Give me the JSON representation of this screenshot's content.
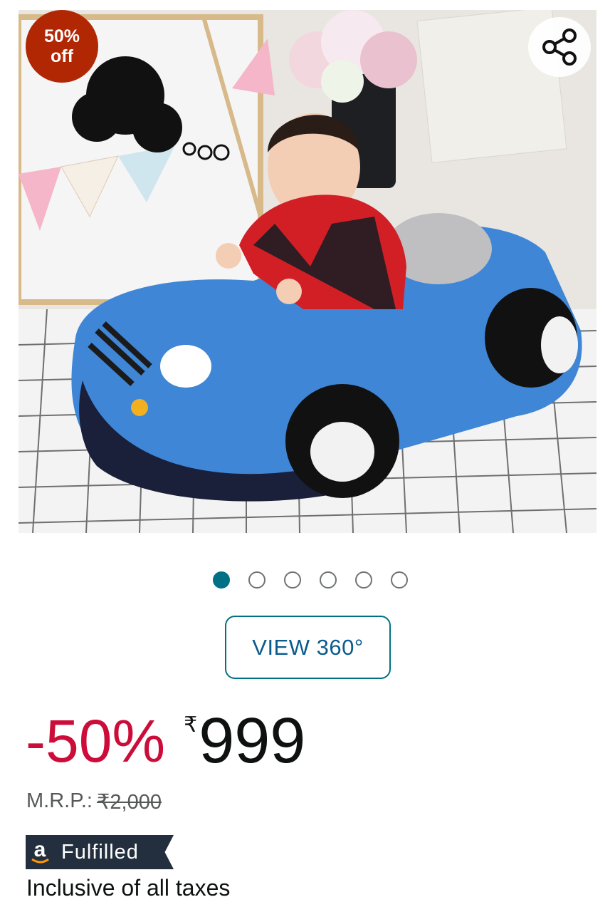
{
  "product": {
    "image_alt": "Baby sitting in a blue plush car-shaped seat",
    "discount_badge": {
      "line1": "50%",
      "line2": "off",
      "color": "#b12704"
    },
    "share_icon": "share-icon",
    "carousel": {
      "total": 6,
      "active_index": 0
    },
    "view360_label": "VIEW 360°"
  },
  "pricing": {
    "savings": "-50%",
    "currency_symbol": "₹",
    "price": "999",
    "mrp_label": "M.R.P.:",
    "mrp_value": "₹2,000"
  },
  "fulfilled": {
    "logo": "a",
    "label": "Fulfilled"
  },
  "tax_note": "Inclusive of all taxes",
  "colors": {
    "accent_teal": "#007185",
    "savings_red": "#cc0c39",
    "badge_dark": "#232f3e"
  }
}
